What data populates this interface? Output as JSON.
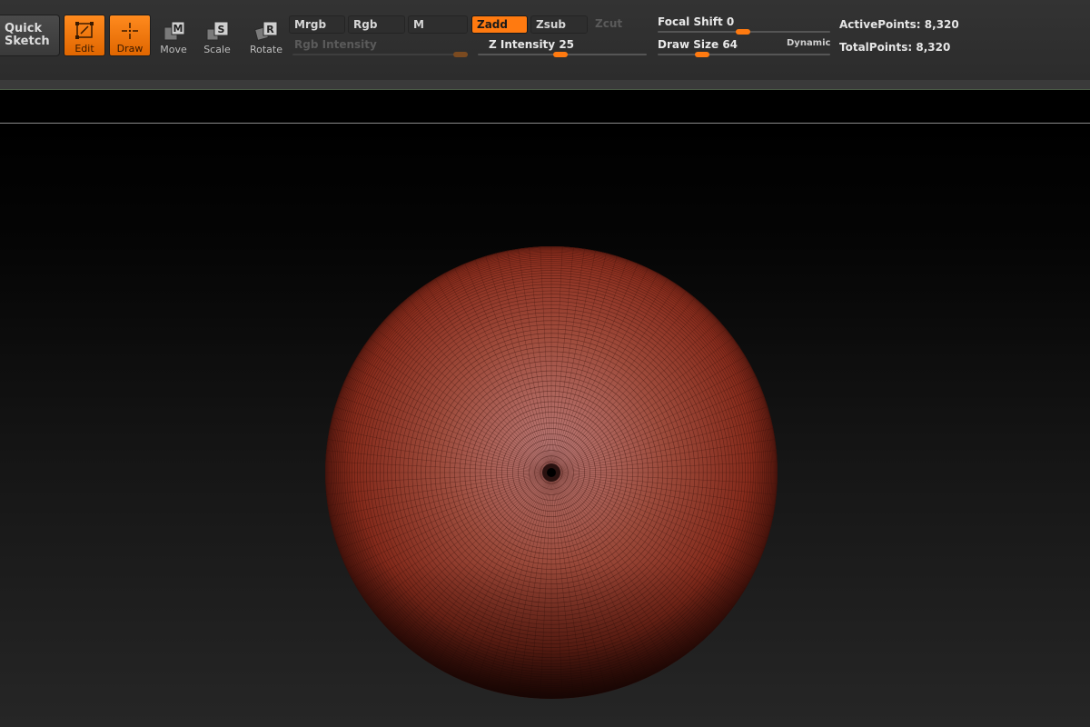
{
  "toolbar": {
    "quick_sketch": [
      "Quick",
      "Sketch"
    ],
    "edit_label": "Edit",
    "draw_label": "Draw",
    "move_label": "Move",
    "scale_label": "Scale",
    "rotate_label": "Rotate",
    "move_key": "M",
    "scale_key": "S",
    "rotate_key": "R",
    "modes": {
      "mrgb": "Mrgb",
      "rgb": "Rgb",
      "m": "M",
      "zadd": "Zadd",
      "zsub": "Zsub",
      "zcut": "Zcut"
    },
    "rgb_intensity_label": "Rgb Intensity",
    "z_intensity_label": "Z Intensity",
    "z_intensity_value": "25",
    "focal_shift_label": "Focal Shift",
    "focal_shift_value": "0",
    "draw_size_label": "Draw Size",
    "draw_size_value": "64",
    "dynamic_label": "Dynamic",
    "active_points_label": "ActivePoints:",
    "active_points_value": "8,320",
    "total_points_label": "TotalPoints:",
    "total_points_value": "8,320"
  },
  "colors": {
    "accent": "#ff7a10",
    "sphere_base": "#8a2e1e",
    "sphere_highlight": "#b87a78"
  },
  "icons": {
    "edit": "edit-frame-icon",
    "draw": "crosshair-icon",
    "move": "move-cube-icon",
    "scale": "scale-cube-icon",
    "rotate": "rotate-cube-icon"
  }
}
